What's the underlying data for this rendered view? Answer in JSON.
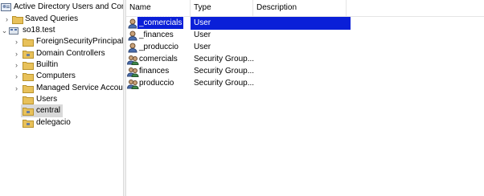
{
  "tree": {
    "root_label": "Active Directory Users and Com",
    "nodes": [
      {
        "label": "Saved Queries"
      },
      {
        "label": "so18.test"
      },
      {
        "label": "ForeignSecurityPrincipals"
      },
      {
        "label": "Domain Controllers"
      },
      {
        "label": "Builtin"
      },
      {
        "label": "Computers"
      },
      {
        "label": "Managed Service Accour"
      },
      {
        "label": "Users"
      },
      {
        "label": "central"
      },
      {
        "label": "delegacio"
      }
    ]
  },
  "list": {
    "columns": [
      "Name",
      "Type",
      "Description"
    ],
    "rows": [
      {
        "name": "_comercials",
        "type": "User",
        "icon": "user-icon",
        "selected": true
      },
      {
        "name": "_finances",
        "type": "User",
        "icon": "user-icon"
      },
      {
        "name": "_produccio",
        "type": "User",
        "icon": "user-icon"
      },
      {
        "name": "comercials",
        "type": "Security Group...",
        "icon": "group-icon"
      },
      {
        "name": "finances",
        "type": "Security Group...",
        "icon": "group-icon"
      },
      {
        "name": "produccio",
        "type": "Security Group...",
        "icon": "group-icon"
      }
    ]
  },
  "colors": {
    "selection": "#0a1fd8",
    "folder": "#e8c15a"
  }
}
